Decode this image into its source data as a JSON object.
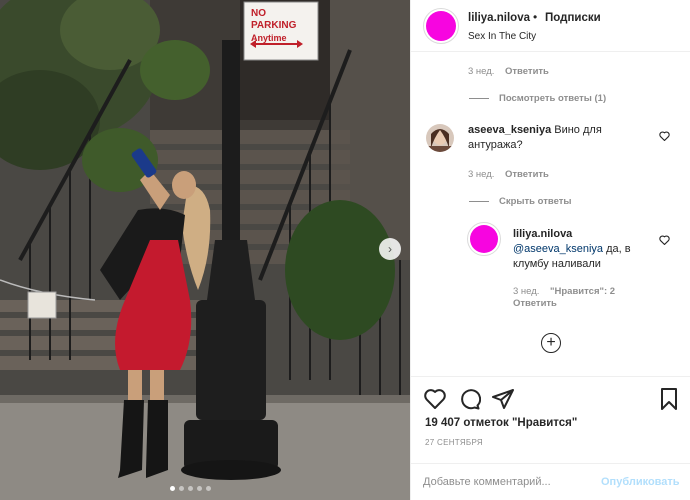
{
  "post": {
    "username": "liliya.nilova",
    "separator": "•",
    "follow_label": "Подписки",
    "location": "Sex In The City"
  },
  "photo": {
    "sign_line1": "NO PARKING",
    "sign_line2": "Anytime",
    "small_sign": "",
    "carousel_next": "›",
    "dots_count": 5,
    "active_dot": 0
  },
  "comments": {
    "first_meta_time": "3 нед.",
    "first_meta_reply": "Ответить",
    "view_replies": "Посмотреть ответы (1)",
    "c2_user": "aseeva_kseniya",
    "c2_text_1": "Вино для",
    "c2_text_2": "антуража?",
    "c2_time": "3 нед.",
    "c2_reply": "Ответить",
    "hide_replies": "Скрыть ответы",
    "r1_user": "liliya.nilova",
    "r1_mention": "@aseeva_kseniya",
    "r1_text_1": " да, в",
    "r1_text_2": "клумбу наливали",
    "r1_time": "3 нед.",
    "r1_likes": "\"Нравится\": 2",
    "r1_reply": "Ответить",
    "heart_icon": "heart-outline-icon",
    "add_more_icon": "plus-circle-icon"
  },
  "actions": {
    "likes_text": "19 407 отметок \"Нравится\"",
    "date_text": "27 СЕНТЯБРЯ",
    "comment_placeholder": "Добавьте комментарий...",
    "publish_label": "Опубликовать",
    "icons": [
      "heart-icon",
      "comment-icon",
      "share-icon",
      "bookmark-icon"
    ]
  },
  "colors": {
    "avatar": "#f705e0",
    "publish_disabled": "#b2dffc",
    "muted": "#8e8e8e",
    "text": "#262626",
    "mention": "#00376b"
  }
}
